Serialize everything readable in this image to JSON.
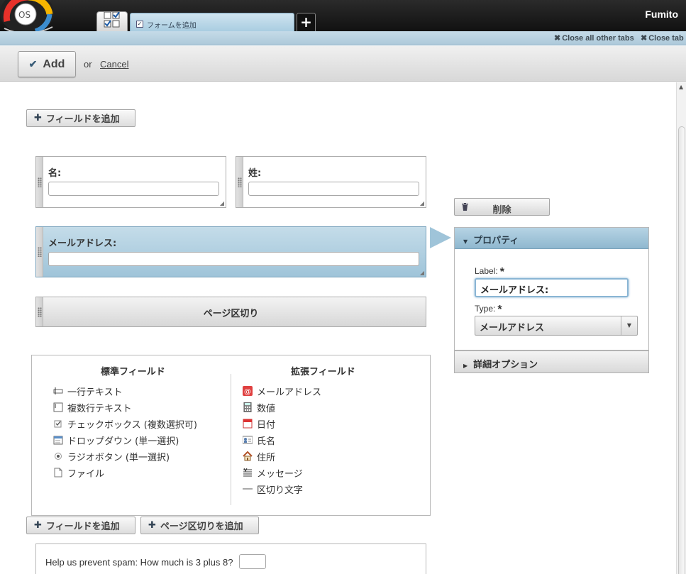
{
  "topbar": {
    "logo_text": "OS",
    "tab_label": "フォームを追加",
    "new_tab": "+",
    "user": "Fumito"
  },
  "subbar": {
    "close_all_other": "Close all other tabs",
    "close_tab": "Close tab"
  },
  "actionbar": {
    "add_label": "Add",
    "or_text": "or",
    "cancel_label": "Cancel"
  },
  "form": {
    "add_field_top": "フィールドを追加",
    "fields": [
      {
        "label": "名:"
      },
      {
        "label": "姓:"
      },
      {
        "label": "メールアドレス:"
      }
    ],
    "page_break_label": "ページ区切り",
    "add_field_bottom": "フィールドを追加",
    "add_page_break": "ページ区切りを追加",
    "spam_question": "Help us prevent spam: How much is 3 plus 8?"
  },
  "palette": {
    "standard_title": "標準フィールド",
    "extended_title": "拡張フィールド",
    "standard": [
      {
        "label": "一行テキスト",
        "icon": "single-line-text-icon"
      },
      {
        "label": "複数行テキスト",
        "icon": "multi-line-text-icon"
      },
      {
        "label": "チェックボックス (複数選択可)",
        "icon": "checkbox-icon"
      },
      {
        "label": "ドロップダウン (単一選択)",
        "icon": "dropdown-icon"
      },
      {
        "label": "ラジオボタン (単一選択)",
        "icon": "radio-icon"
      },
      {
        "label": "ファイル",
        "icon": "file-icon"
      }
    ],
    "extended": [
      {
        "label": "メールアドレス",
        "icon": "email-icon"
      },
      {
        "label": "数値",
        "icon": "number-icon"
      },
      {
        "label": "日付",
        "icon": "calendar-icon"
      },
      {
        "label": "氏名",
        "icon": "name-card-icon"
      },
      {
        "label": "住所",
        "icon": "house-icon"
      },
      {
        "label": "メッセージ",
        "icon": "message-icon"
      },
      {
        "label": "区切り文字",
        "icon": "separator-icon"
      }
    ]
  },
  "properties": {
    "delete_label": "削除",
    "header": "プロパティ",
    "label_caption": "Label:",
    "label_value": "メールアドレス:",
    "type_caption": "Type:",
    "type_value": "メールアドレス",
    "required_mark": "*",
    "advanced_label": "詳細オプション"
  },
  "colors": {
    "accent_blue": "#9fc4d9",
    "topbar_dark": "#1a1a1a"
  }
}
